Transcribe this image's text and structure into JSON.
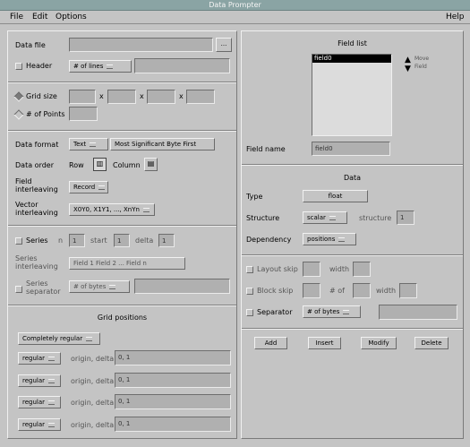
{
  "window": {
    "title": "Data Prompter"
  },
  "menu": {
    "file": "File",
    "edit": "Edit",
    "options": "Options",
    "help": "Help"
  },
  "left": {
    "data_file": {
      "label": "Data file",
      "value": "",
      "browse": "..."
    },
    "header": {
      "label": "Header",
      "option": "# of lines",
      "value": ""
    },
    "grid_size": {
      "label": "Grid size",
      "values": [
        "",
        "",
        "",
        ""
      ],
      "sep": "x"
    },
    "num_points": {
      "label": "# of Points",
      "value": ""
    },
    "data_format": {
      "label": "Data format",
      "option": "Text",
      "option2": "Most Significant Byte First"
    },
    "data_order": {
      "label": "Data order",
      "row": "Row",
      "column": "Column"
    },
    "field_interleaving": {
      "label": "Field interleaving",
      "option": "Record"
    },
    "vector_interleaving": {
      "label": "Vector interleaving",
      "option": "X0Y0, X1Y1, ..., XnYn"
    },
    "series": {
      "label": "Series",
      "n": "n",
      "start": "start",
      "delta": "delta",
      "n_val": "1",
      "start_val": "1",
      "delta_val": "1"
    },
    "series_interleaving": {
      "label": "Series interleaving",
      "option": "Field 1 Field 2 ... Field n"
    },
    "series_separator": {
      "label": "Series separator",
      "option": "# of bytes",
      "value": ""
    },
    "grid_positions": {
      "title": "Grid positions",
      "mode": "Completely regular",
      "rows": [
        {
          "option": "regular",
          "label": "origin, delta",
          "value": "0, 1"
        },
        {
          "option": "regular",
          "label": "origin, delta",
          "value": "0, 1"
        },
        {
          "option": "regular",
          "label": "origin, delta",
          "value": "0, 1"
        },
        {
          "option": "regular",
          "label": "origin, delta",
          "value": "0, 1"
        }
      ]
    }
  },
  "right": {
    "field_list": {
      "title": "Field list",
      "items": [
        "field0"
      ],
      "move_up": "Move",
      "move_down": "Field"
    },
    "field_name": {
      "label": "Field name",
      "value": "field0"
    },
    "data_title": "Data",
    "type": {
      "label": "Type",
      "value": "float"
    },
    "structure": {
      "label": "Structure",
      "value": "scalar",
      "label2": "structure",
      "value2": "1"
    },
    "dependency": {
      "label": "Dependency",
      "value": "positions"
    },
    "layout": {
      "label": "Layout skip",
      "width_label": "width",
      "skip_val": "",
      "width_val": ""
    },
    "block": {
      "label": "Block skip",
      "elements": "# of",
      "width": "width",
      "skip_val": "",
      "el_val": "",
      "width_val": ""
    },
    "separator": {
      "label": "Separator",
      "option": "# of bytes",
      "value": ""
    },
    "buttons": {
      "add": "Add",
      "insert": "Insert",
      "modify": "Modify",
      "delete": "Delete"
    }
  }
}
